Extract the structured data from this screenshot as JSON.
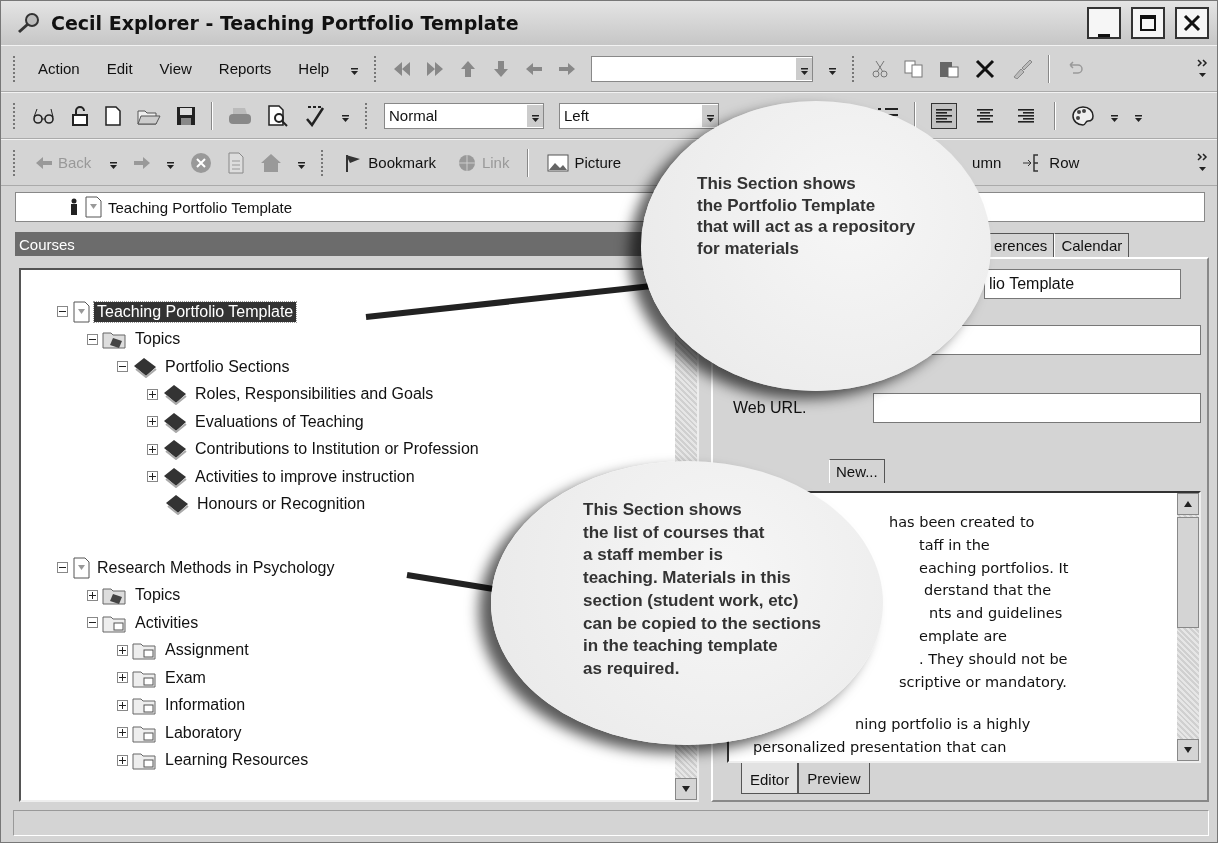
{
  "window": {
    "title": "Cecil Explorer - Teaching Portfolio Template"
  },
  "menu": [
    "Action",
    "Edit",
    "View",
    "Reports",
    "Help"
  ],
  "format_bar": {
    "style": "Normal",
    "alignment": "Left",
    "align_buttons": [
      {
        "kind": "left",
        "selected": true
      },
      {
        "kind": "center",
        "selected": false
      },
      {
        "kind": "right",
        "selected": false
      }
    ]
  },
  "nav_bar": [
    {
      "kind": "back",
      "label": "Back",
      "disabled": true
    },
    {
      "kind": "bookmark",
      "label": "Bookmark",
      "disabled": false
    },
    {
      "kind": "link",
      "label": "Link",
      "disabled": true
    },
    {
      "kind": "picture",
      "label": "Picture",
      "disabled": false
    },
    {
      "kind": "column",
      "label": "umn",
      "disabled": false
    },
    {
      "kind": "row",
      "label": "Row",
      "disabled": false
    }
  ],
  "address": "Teaching Portfolio Template",
  "courses": {
    "title": "Courses",
    "tree": [
      {
        "label": "Teaching Portfolio Template",
        "kind": "course",
        "expanded": true,
        "selected": true,
        "children": [
          {
            "label": "Topics",
            "kind": "topics",
            "expanded": true,
            "selected": false,
            "children": [
              {
                "label": "Portfolio Sections",
                "kind": "book",
                "expanded": true,
                "selected": false,
                "children": [
                  {
                    "label": "Roles, Responsibilities and Goals",
                    "kind": "book",
                    "expanded": false,
                    "selected": false
                  },
                  {
                    "label": "Evaluations of Teaching",
                    "kind": "book",
                    "expanded": false,
                    "selected": false
                  },
                  {
                    "label": "Contributions to Institution or Profession",
                    "kind": "book",
                    "expanded": false,
                    "selected": false
                  },
                  {
                    "label": "Activities to improve instruction",
                    "kind": "book",
                    "expanded": false,
                    "selected": false
                  },
                  {
                    "label": "Honours or Recognition",
                    "kind": "book",
                    "selected": false
                  }
                ]
              }
            ]
          }
        ]
      },
      {
        "label": "Research Methods in Psychology",
        "kind": "course",
        "expanded": true,
        "selected": false,
        "children": [
          {
            "label": "Topics",
            "kind": "topics",
            "expanded": false,
            "selected": false
          },
          {
            "label": "Activities",
            "kind": "folder",
            "expanded": true,
            "selected": false,
            "children": [
              {
                "label": "Assignment",
                "kind": "folder",
                "expanded": false,
                "selected": false
              },
              {
                "label": "Exam",
                "kind": "folder",
                "expanded": false,
                "selected": false
              },
              {
                "label": "Information",
                "kind": "folder",
                "expanded": false,
                "selected": false
              },
              {
                "label": "Laboratory",
                "kind": "folder",
                "expanded": false,
                "selected": false
              },
              {
                "label": "Learning Resources",
                "kind": "folder",
                "expanded": false,
                "selected": false
              }
            ]
          }
        ]
      }
    ]
  },
  "details": {
    "tabs": [
      {
        "label": "erences",
        "selected": false
      },
      {
        "label": "Calendar",
        "selected": false
      }
    ],
    "title_value": "lio Template",
    "web_url_label": "Web URL.",
    "sub_tabs": [
      {
        "label": "New...",
        "selected": false
      }
    ],
    "editor_paragraphs": [
      [
        "has been created to",
        "taff in the",
        "eaching portfolios. It",
        "derstand that the",
        "nts and guidelines",
        "emplate are",
        ". They should not be",
        "scriptive or mandatory."
      ],
      [
        "ning portfolio is a highly",
        "personalized presentation that can"
      ]
    ],
    "editor_tabs": [
      {
        "label": "Editor",
        "selected": true
      },
      {
        "label": "Preview",
        "selected": false
      }
    ]
  },
  "callouts": [
    {
      "text": "This Section shows\nthe Portfolio Template\nthat will act as a repository\nfor materials"
    },
    {
      "text": "This Section shows\nthe list of courses that\na staff member is\nteaching.  Materials in this\nsection (student work, etc)\ncan be copied to the sections\nin the teaching template\nas required."
    }
  ]
}
